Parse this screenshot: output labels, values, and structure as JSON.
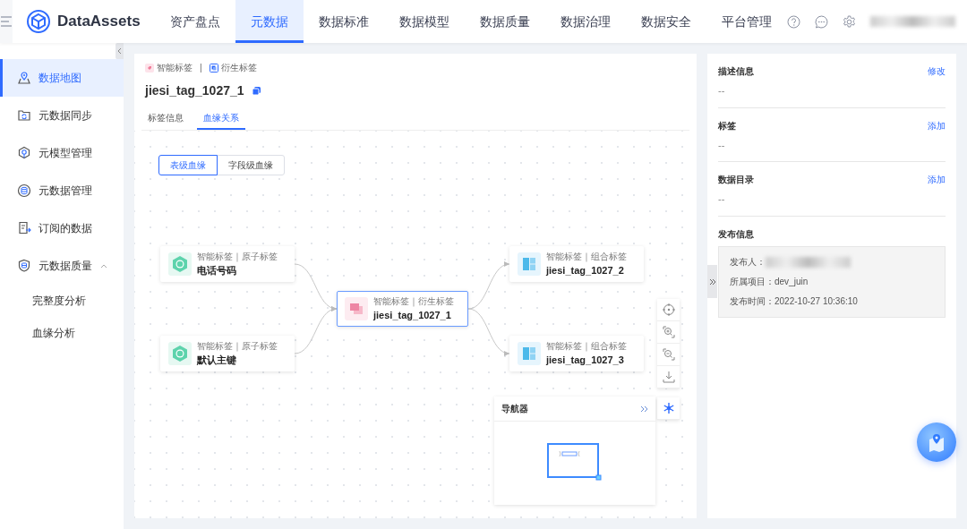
{
  "nav": {
    "brand": "DataAssets",
    "items": [
      {
        "label": "资产盘点",
        "selected": false
      },
      {
        "label": "元数据",
        "selected": true
      },
      {
        "label": "数据标准",
        "selected": false
      },
      {
        "label": "数据模型",
        "selected": false
      },
      {
        "label": "数据质量",
        "selected": false
      },
      {
        "label": "数据治理",
        "selected": false
      },
      {
        "label": "数据安全",
        "selected": false
      },
      {
        "label": "平台管理",
        "selected": false
      }
    ]
  },
  "sidebar": {
    "items": [
      {
        "label": "数据地图",
        "selected": true
      },
      {
        "label": "元数据同步",
        "selected": false
      },
      {
        "label": "元模型管理",
        "selected": false
      },
      {
        "label": "元数据管理",
        "selected": false
      },
      {
        "label": "订阅的数据",
        "selected": false
      },
      {
        "label": "元数据质量",
        "selected": false,
        "expanded": true,
        "children": [
          {
            "label": "完整度分析",
            "selected": false
          },
          {
            "label": "血缘分析",
            "selected": false
          }
        ]
      }
    ]
  },
  "detail": {
    "tags": [
      {
        "label": "智能标签",
        "kind": "smart"
      },
      {
        "label": "衍生标签",
        "kind": "derived"
      }
    ],
    "separator": "|",
    "title": "jiesi_tag_1027_1",
    "tabs": [
      {
        "label": "标签信息",
        "selected": false
      },
      {
        "label": "血缘关系",
        "selected": true
      }
    ]
  },
  "lineage": {
    "levels": [
      {
        "label": "表级血缘",
        "selected": true
      },
      {
        "label": "字段级血缘",
        "selected": false
      }
    ],
    "nodes": [
      {
        "category": "智能标签｜原子标签",
        "name": "电话号码",
        "kind": "atomic",
        "selected": false
      },
      {
        "category": "智能标签｜原子标签",
        "name": "默认主键",
        "kind": "atomic",
        "selected": false
      },
      {
        "category": "智能标签｜衍生标签",
        "name": "jiesi_tag_1027_1",
        "kind": "derived",
        "selected": true
      },
      {
        "category": "智能标签｜组合标签",
        "name": "jiesi_tag_1027_2",
        "kind": "composite",
        "selected": false
      },
      {
        "category": "智能标签｜组合标签",
        "name": "jiesi_tag_1027_3",
        "kind": "composite",
        "selected": false
      }
    ],
    "navigator": {
      "title": "导航器"
    }
  },
  "info": {
    "sections": [
      {
        "title": "描述信息",
        "action": "修改",
        "value": "--"
      },
      {
        "title": "标签",
        "action": "添加",
        "value": "--"
      },
      {
        "title": "数据目录",
        "action": "添加",
        "value": "--"
      }
    ],
    "publish": {
      "title": "发布信息",
      "fields": [
        {
          "label": "发布人："
        },
        {
          "label": "所属项目：",
          "value": "dev_juin"
        },
        {
          "label": "发布时间：",
          "value": "2022-10-27 10:36:10"
        }
      ]
    }
  }
}
